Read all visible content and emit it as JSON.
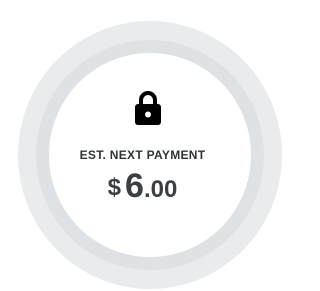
{
  "payment": {
    "label": "EST. NEXT PAYMENT",
    "currency_symbol": "$",
    "amount_whole": "6",
    "amount_cents": ".00"
  },
  "icons": {
    "lock": "lock-icon"
  },
  "colors": {
    "outer_ring": "#e9ebed",
    "mid_ring": "#dfe2e5",
    "text": "#2f3437",
    "icon": "#000000"
  }
}
